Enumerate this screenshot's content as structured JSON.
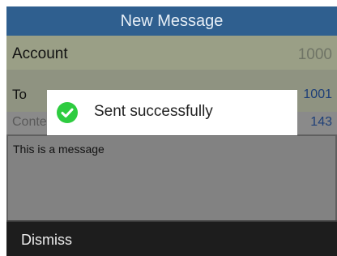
{
  "header": {
    "title": "New Message"
  },
  "form": {
    "account_label": "Account",
    "account_value": "1000",
    "to_label": "To",
    "to_value": "1001",
    "content_label": "Conte",
    "content_count": "143",
    "message_text": "This is a message"
  },
  "toast": {
    "text": "Sent successfully",
    "icon": "check-circle-icon"
  },
  "softkeys": {
    "dismiss": "Dismiss"
  },
  "colors": {
    "titlebar": "#2f5f8f",
    "success": "#2ecc40",
    "softbar": "#1d1d1d"
  }
}
